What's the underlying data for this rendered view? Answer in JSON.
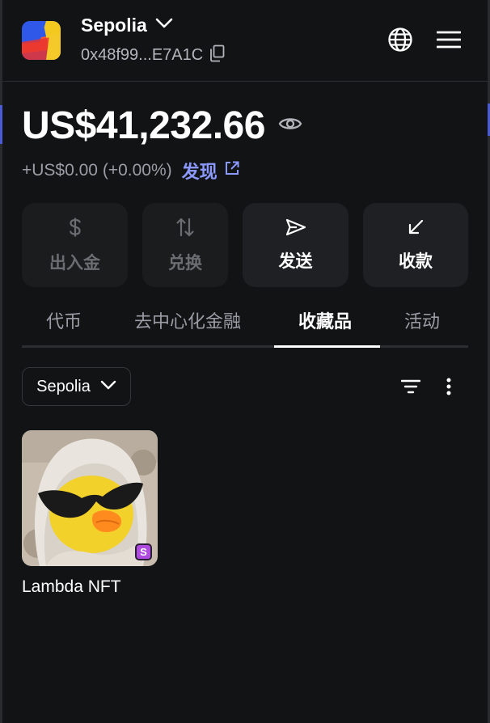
{
  "header": {
    "network_name": "Sepolia",
    "address": "0x48f99...E7A1C",
    "icons": [
      "chevron-down-icon",
      "copy-icon",
      "globe-icon",
      "menu-icon"
    ]
  },
  "balance": {
    "amount": "US$41,232.66",
    "change": "+US$0.00 (+0.00%)",
    "discover_label": "发现"
  },
  "actions": [
    {
      "label": "出入金",
      "icon": "dollar-icon",
      "enabled": false
    },
    {
      "label": "兑换",
      "icon": "swap-icon",
      "enabled": false
    },
    {
      "label": "发送",
      "icon": "send-icon",
      "enabled": true
    },
    {
      "label": "收款",
      "icon": "receive-icon",
      "enabled": true
    }
  ],
  "tabs": [
    {
      "label": "代币",
      "active": false
    },
    {
      "label": "去中心化金融",
      "active": false
    },
    {
      "label": "收藏品",
      "active": true
    },
    {
      "label": "活动",
      "active": false
    }
  ],
  "collectibles": {
    "network_filter": "Sepolia",
    "items": [
      {
        "name": "Lambda NFT",
        "network_badge": "S"
      }
    ]
  },
  "colors": {
    "background": "#121314",
    "accent": "#8b99ff",
    "card": "#1f2023",
    "badge": "#b04be0"
  }
}
